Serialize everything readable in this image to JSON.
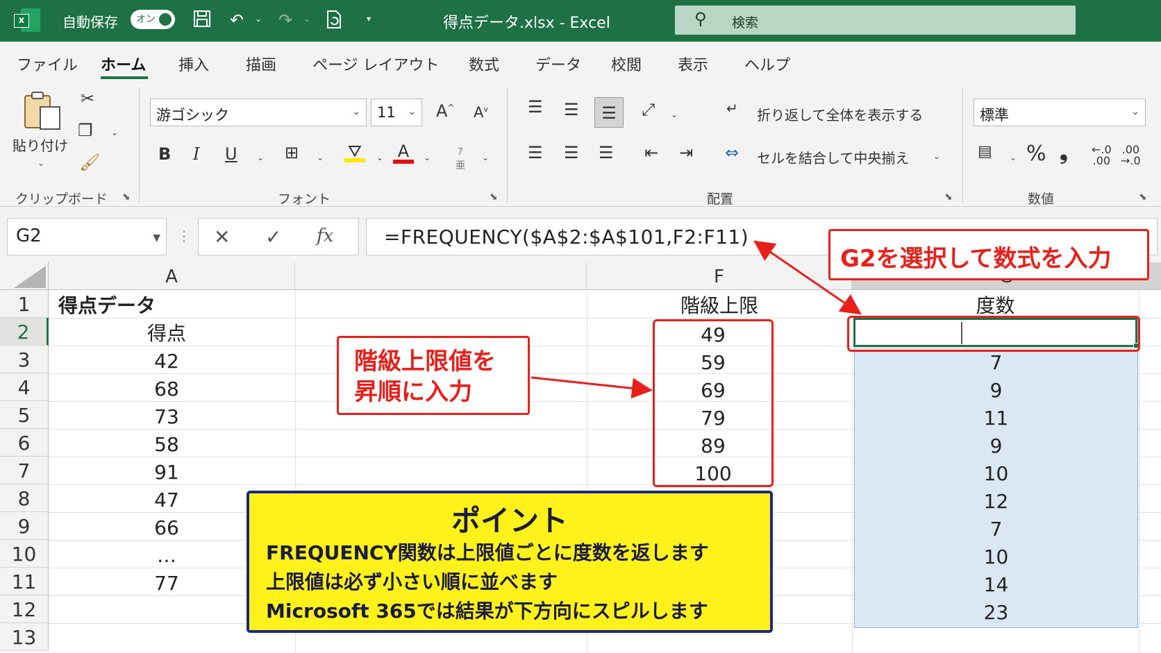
{
  "titlebar": {
    "autosave_label": "自動保存",
    "autosave_state": "オン",
    "doc_title": "得点データ.xlsx  -  Excel",
    "search_placeholder": "検索"
  },
  "tabs": [
    "ファイル",
    "ホーム",
    "挿入",
    "描画",
    "ページ レイアウト",
    "数式",
    "データ",
    "校閲",
    "表示",
    "ヘルプ"
  ],
  "active_tab": "ホーム",
  "ribbon": {
    "clipboard": {
      "paste_label": "貼り付け",
      "group_label": "クリップボード"
    },
    "font": {
      "font_name": "游ゴシック",
      "font_size": "11",
      "group_label": "フォント",
      "bold": "B",
      "italic": "I",
      "underline": "U",
      "grow": "A",
      "shrink": "A",
      "font_color": "A"
    },
    "alignment": {
      "wrap_text": "折り返して全体を表示する",
      "merge_center": "セルを結合して中央揃え",
      "group_label": "配置"
    },
    "number": {
      "format": "標準",
      "percent": "%",
      "comma": "❟",
      "group_label": "数値"
    }
  },
  "formula_bar": {
    "name_box": "G2",
    "cancel": "✕",
    "enter": "✓",
    "fx": "fx",
    "formula": "=FREQUENCY($A$2:$A$101,F2:F11)"
  },
  "columns": [
    "A",
    "F",
    "G"
  ],
  "rows": [
    "1",
    "2",
    "3",
    "4",
    "5",
    "6",
    "7",
    "8",
    "9",
    "10",
    "11",
    "12",
    "13"
  ],
  "sheet": {
    "a1_title": "得点データ",
    "col_a": [
      "得点",
      "42",
      "68",
      "73",
      "58",
      "91",
      "47",
      "66",
      "…",
      "77"
    ],
    "f1_header": "階級上限",
    "col_f": [
      "49",
      "59",
      "69",
      "79",
      "89",
      "100"
    ],
    "g1_header": "度数",
    "col_g": [
      "7",
      "9",
      "11",
      "9",
      "10",
      "12",
      "7",
      "10",
      "14",
      "23"
    ]
  },
  "annotations": {
    "select_g2": "G2を選択して数式を入力",
    "bounds_line1": "階級上限値を",
    "bounds_line2": "昇順に入力",
    "point_title": "ポイント",
    "point_lines": [
      "FREQUENCY関数は上限値ごとに度数を返します",
      "上限値は必ず小さい順に並べます",
      "Microsoft 365では結果が下方向にスピルします"
    ]
  },
  "colors": {
    "excel_green": "#1e7145",
    "annotation_red": "#e8201c",
    "point_yellow": "#fff21a",
    "point_border": "#1b2a80",
    "spill_blue": "#dbe7f3"
  }
}
